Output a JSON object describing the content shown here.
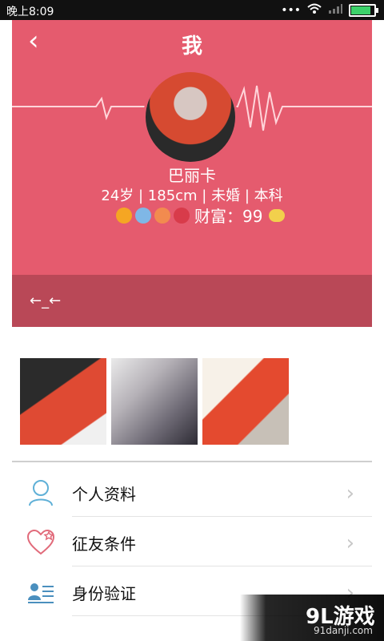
{
  "status_bar": {
    "time": "晚上8:09"
  },
  "header": {
    "title": "我"
  },
  "profile": {
    "name": "巴丽卡",
    "details": "24岁 | 185cm | 未婚 | 本科",
    "wealth_text": "财富：99"
  },
  "signature": {
    "text": "←_←"
  },
  "menu": {
    "items": [
      {
        "label": "个人资料"
      },
      {
        "label": "征友条件"
      },
      {
        "label": "身份验证"
      }
    ]
  },
  "watermark": {
    "text": "9L游戏",
    "sub": "91danji.com"
  }
}
